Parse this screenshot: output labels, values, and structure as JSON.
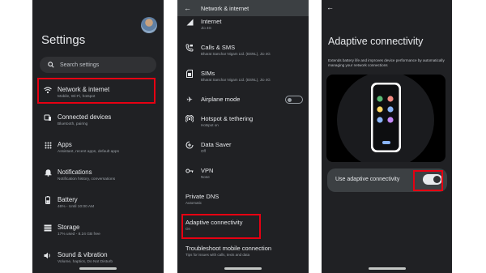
{
  "settings": {
    "title": "Settings",
    "search_placeholder": "Search settings",
    "items": [
      {
        "title": "Network & internet",
        "subtitle": "Mobile, Wi-Fi, hotspot",
        "icon": "wifi-icon"
      },
      {
        "title": "Connected devices",
        "subtitle": "Bluetooth, pairing",
        "icon": "devices-icon"
      },
      {
        "title": "Apps",
        "subtitle": "Assistant, recent apps, default apps",
        "icon": "apps-icon"
      },
      {
        "title": "Notifications",
        "subtitle": "Notification history, conversations",
        "icon": "bell-icon"
      },
      {
        "title": "Battery",
        "subtitle": "46% - Until 10:00 AM",
        "icon": "battery-icon"
      },
      {
        "title": "Storage",
        "subtitle": "17% used - 8.24 GB free",
        "icon": "storage-icon"
      },
      {
        "title": "Sound & vibration",
        "subtitle": "Volume, haptics, Do Not Disturb",
        "icon": "sound-icon"
      }
    ]
  },
  "network": {
    "header": "Network & internet",
    "items": [
      {
        "title": "Internet",
        "subtitle": "Jio 4G",
        "icon": "signal-icon"
      },
      {
        "title": "Calls & SMS",
        "subtitle": "Bharat Sanchar Nigam Ltd. (BSNL), Jio 4G",
        "icon": "calls-sms-icon"
      },
      {
        "title": "SIMs",
        "subtitle": "Bharat Sanchar Nigam Ltd. (BSNL), Jio 4G",
        "icon": "sim-icon"
      },
      {
        "title": "Airplane mode",
        "subtitle": "",
        "icon": "airplane-icon"
      },
      {
        "title": "Hotspot & tethering",
        "subtitle": "Hotspot on",
        "icon": "hotspot-icon"
      },
      {
        "title": "Data Saver",
        "subtitle": "Off",
        "icon": "data-saver-icon"
      },
      {
        "title": "VPN",
        "subtitle": "None",
        "icon": "vpn-key-icon"
      },
      {
        "title": "Private DNS",
        "subtitle": "Automatic",
        "icon": ""
      },
      {
        "title": "Adaptive connectivity",
        "subtitle": "On",
        "icon": ""
      },
      {
        "title": "Troubleshoot mobile connection",
        "subtitle": "Tips for issues with calls, texts and data",
        "icon": ""
      }
    ],
    "airplane_mode_on": false
  },
  "adaptive": {
    "title": "Adaptive connectivity",
    "description": "Extends battery life and improves device performance by automatically managing your network connections",
    "toggle_label": "Use adaptive connectivity",
    "toggle_on": true
  },
  "colors": {
    "background": "#202124",
    "highlight": "#e60012"
  }
}
